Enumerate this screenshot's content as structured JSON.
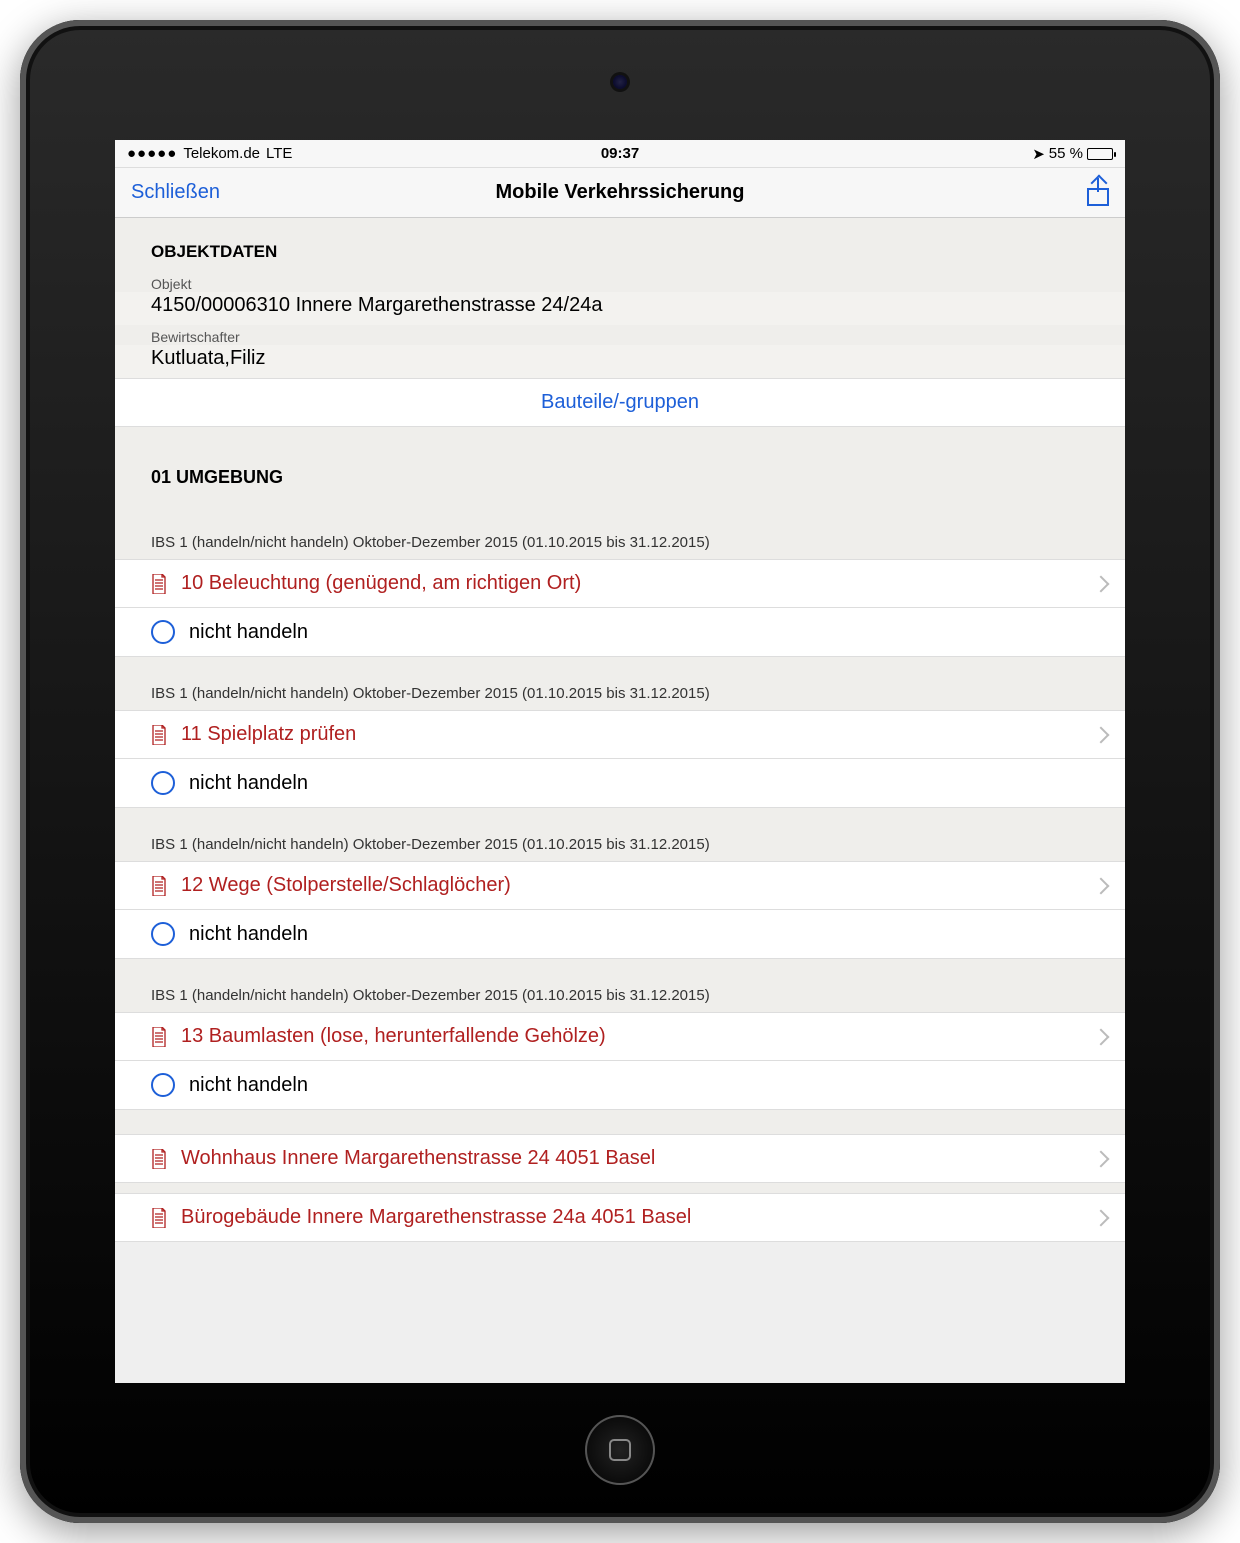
{
  "status": {
    "carrier": "Telekom.de",
    "network": "LTE",
    "time": "09:37",
    "battery_pct": "55 %"
  },
  "nav": {
    "close": "Schließen",
    "title": "Mobile Verkehrssicherung"
  },
  "objektdaten": {
    "header": "OBJEKTDATEN",
    "objekt_label": "Objekt",
    "objekt_value": "4150/00006310 Innere Margarethenstrasse 24/24a",
    "bewirt_label": "Bewirtschafter",
    "bewirt_value": "Kutluata,Filiz",
    "link": "Bauteile/-gruppen"
  },
  "section": {
    "title": "01 UMGEBUNG",
    "ibs_label": "IBS 1 (handeln/nicht handeln) Oktober-Dezember 2015 (01.10.2015 bis 31.12.2015)",
    "nicht_handeln": "nicht handeln",
    "items": [
      {
        "title": "10 Beleuchtung (genügend, am richtigen Ort)"
      },
      {
        "title": "11 Spielplatz prüfen"
      },
      {
        "title": "12 Wege (Stolperstelle/Schlaglöcher)"
      },
      {
        "title": "13 Baumlasten (lose, herunterfallende Gehölze)"
      }
    ]
  },
  "buildings": [
    {
      "title": "Wohnhaus Innere Margarethenstrasse 24  4051 Basel"
    },
    {
      "title": "Bürogebäude Innere Margarethenstrasse 24a  4051 Basel"
    }
  ]
}
